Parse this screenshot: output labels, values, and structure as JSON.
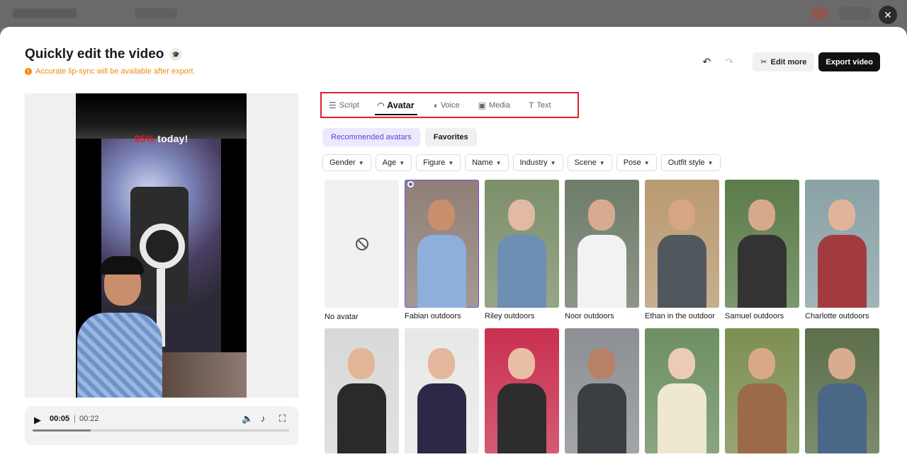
{
  "overlay": {
    "close_glyph": "✕"
  },
  "header": {
    "title": "Quickly edit the video",
    "title_icon": "graduation-cap-icon",
    "notice": "Accurate lip-sync will be available after export.",
    "notice_color": "#f08a0c"
  },
  "actions": {
    "undo_glyph": "↶",
    "redo_glyph": "↷",
    "edit_more_label": "Edit more",
    "edit_more_icon": "scissors-icon",
    "export_label": "Export video"
  },
  "video": {
    "caption_pct": "95%",
    "caption_rest": " today!"
  },
  "player": {
    "current_time": "00:05",
    "separator": "|",
    "total_time": "00:22",
    "progress": 0.227
  },
  "tabs": [
    {
      "label": "Script",
      "icon": "script-icon",
      "glyph": "☰",
      "active": false
    },
    {
      "label": "Avatar",
      "icon": "avatar-icon",
      "glyph": "◠",
      "active": true
    },
    {
      "label": "Voice",
      "icon": "voice-icon",
      "glyph": "◖",
      "active": false
    },
    {
      "label": "Media",
      "icon": "media-icon",
      "glyph": "▣",
      "active": false
    },
    {
      "label": "Text",
      "icon": "text-icon",
      "glyph": "T",
      "active": false
    }
  ],
  "subtabs": [
    "Recommended avatars",
    "Favorites"
  ],
  "filters": [
    "Gender",
    "Age",
    "Figure",
    "Name",
    "Industry",
    "Scene",
    "Pose",
    "Outfit style"
  ],
  "avatars_row1": [
    {
      "name": "No avatar",
      "empty": true
    },
    {
      "name": "Fabian outdoors",
      "selected": true,
      "bg": "#8f7f77",
      "skin": "#c98e6c",
      "shirt": "#8eaedc"
    },
    {
      "name": "Riley outdoors",
      "bg": "#7c8f6b",
      "skin": "#e2b9a5",
      "shirt": "#6c8fb3"
    },
    {
      "name": "Noor outdoors",
      "bg": "#6f7c6a",
      "skin": "#d8ab90",
      "shirt": "#f2f2f2"
    },
    {
      "name": "Ethan in the outdoor",
      "bg": "#b99a72",
      "skin": "#d7a584",
      "shirt": "#50585e"
    },
    {
      "name": "Samuel outdoors",
      "bg": "#5c7c4a",
      "skin": "#d6a98c",
      "shirt": "#333333"
    },
    {
      "name": "Charlotte outdoors",
      "bg": "#8aa2a6",
      "skin": "#e0b49a",
      "shirt": "#a23b3f"
    }
  ],
  "avatars_row2": [
    {
      "bg": "#d9d9d9",
      "skin": "#e3b597",
      "shirt": "#2a2a2a"
    },
    {
      "bg": "#e8e8e8",
      "skin": "#e4b79c",
      "shirt": "#2e2846"
    },
    {
      "bg": "#c93150",
      "skin": "#e8bfa5",
      "shirt": "#2d2d2d"
    },
    {
      "bg": "#8c8f93",
      "skin": "#b88064",
      "shirt": "#3a3f44"
    },
    {
      "bg": "#6d8f62",
      "skin": "#eccbb6",
      "shirt": "#efe8d0"
    },
    {
      "bg": "#7d8f52",
      "skin": "#d9a887",
      "shirt": "#9b6a4a"
    },
    {
      "bg": "#5c6e4a",
      "skin": "#d9ac8f",
      "shirt": "#4b6788"
    }
  ]
}
